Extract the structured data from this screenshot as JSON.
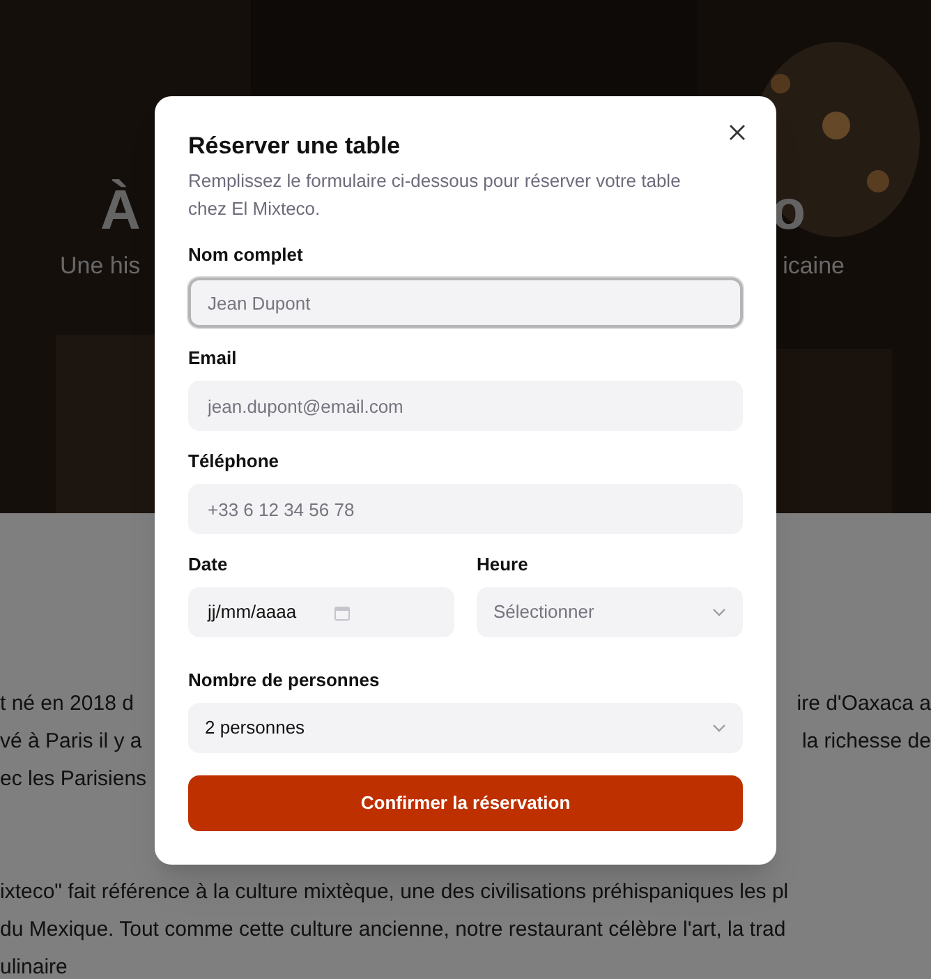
{
  "hero": {
    "title_left": "À",
    "title_right": "o",
    "subtitle_left": "Une his",
    "subtitle_right": "icaine"
  },
  "story": [
    {
      "lines": [
        {
          "left": "t né en 2018 d",
          "right": "ire d'Oaxaca a"
        },
        {
          "left": "vé à Paris il y a",
          "right": "la richesse de"
        },
        {
          "left": "ec les Parisiens"
        }
      ]
    },
    {
      "lines": [
        {
          "left": "ixteco\" fait référence à la culture mixtèque, une des civilisations préhispaniques les pl"
        },
        {
          "left": "du Mexique. Tout comme cette culture ancienne, notre restaurant célèbre l'art, la trad"
        },
        {
          "left": "ulinaire"
        }
      ]
    }
  ],
  "dialog": {
    "title": "Réserver une table",
    "description": "Remplissez le formulaire ci-dessous pour réserver votre table chez El Mixteco.",
    "rows": [
      [
        {
          "kind": "text",
          "label": "Nom complet",
          "placeholder": "Jean Dupont",
          "focused": true
        }
      ],
      [
        {
          "kind": "text",
          "label": "Email",
          "placeholder": "jean.dupont@email.com",
          "focused": false
        }
      ],
      [
        {
          "kind": "text",
          "label": "Téléphone",
          "placeholder": "+33 6 12 34 56 78",
          "focused": false
        }
      ],
      [
        {
          "kind": "date",
          "label": "Date",
          "value": "jj/mm/aaaa"
        },
        {
          "kind": "select",
          "label": "Heure",
          "placeholder": "Sélectionner"
        }
      ],
      [
        {
          "kind": "select",
          "label": "Nombre de personnes",
          "value": "2 personnes"
        }
      ]
    ],
    "submit": "Confirmer la réservation"
  }
}
